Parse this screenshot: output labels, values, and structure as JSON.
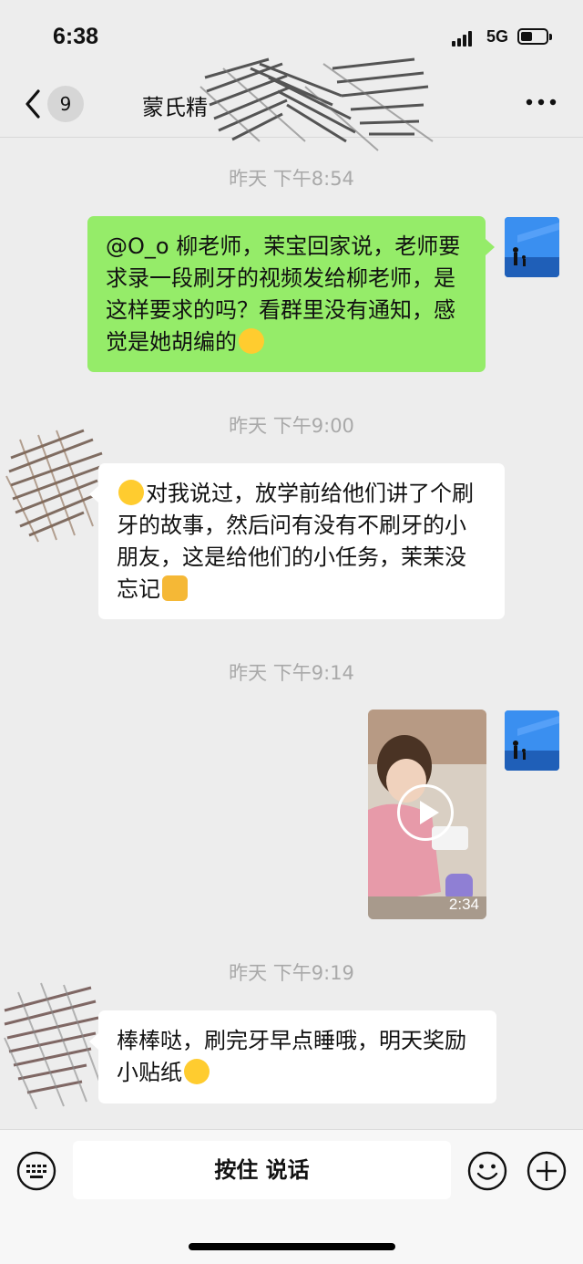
{
  "status_bar": {
    "time": "6:38",
    "network": "5G"
  },
  "header": {
    "unread_count": "9",
    "title": "蒙氏精"
  },
  "messages": [
    {
      "timestamp": "昨天 下午8:54",
      "side": "right",
      "type": "text",
      "text": "@O_o 柳老师，茉宝回家说，老师要求录一段刷牙的视频发给柳老师，是这样要求的吗？看群里没有通知，感觉是她胡编的",
      "trailing_emoji": "tears-of-joy-emoji"
    },
    {
      "timestamp": "昨天 下午9:00",
      "side": "left",
      "type": "text",
      "leading_emoji": "tears-of-joy-emoji",
      "text": "对我说过，放学前给他们讲了个刷牙的故事，然后问有没有不刷牙的小朋友，这是给他们的小任务，茉茉没忘记",
      "trailing_emoji": "thumbs-up-emoji"
    },
    {
      "timestamp": "昨天 下午9:14",
      "side": "right",
      "type": "video",
      "duration": "2:34"
    },
    {
      "timestamp": "昨天 下午9:19",
      "side": "left",
      "type": "text",
      "text": "棒棒哒，刷完牙早点睡哦，明天奖励小贴纸",
      "trailing_emoji": "winking-tongue-emoji"
    }
  ],
  "input_bar": {
    "voice_button_label": "按住 说话"
  },
  "colors": {
    "sent_bubble": "#95ec69",
    "received_bubble": "#ffffff",
    "background": "#ededed",
    "timestamp": "#a9a9a9"
  }
}
